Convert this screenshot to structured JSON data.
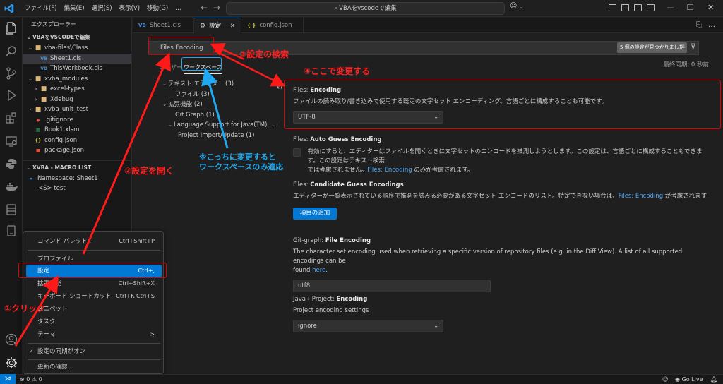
{
  "menubar": {
    "items": [
      "ファイル(F)",
      "編集(E)",
      "選択(S)",
      "表示(V)",
      "移動(G)",
      "…"
    ]
  },
  "command_center": {
    "text": "VBAをvscodeで編集"
  },
  "tabs": [
    {
      "icon": "VB",
      "label": "Sheet1.cls"
    },
    {
      "icon": "gear",
      "label": "設定"
    },
    {
      "icon": "{ }",
      "label": "config.json"
    }
  ],
  "sidebar": {
    "header": "エクスプローラー",
    "section_title": "VBAをVSCODEで編集",
    "tree": [
      {
        "label": "vba-files\\Class",
        "type": "folder",
        "open": true,
        "level": 1
      },
      {
        "label": "Sheet1.cls",
        "type": "vb",
        "level": 3,
        "selected": true
      },
      {
        "label": "ThisWorkbook.cls",
        "type": "vb",
        "level": 3
      },
      {
        "label": "xvba_modules",
        "type": "folder",
        "open": true,
        "level": 1
      },
      {
        "label": "excel-types",
        "type": "folder",
        "open": false,
        "level": 2
      },
      {
        "label": "Xdebug",
        "type": "folder",
        "open": false,
        "level": 2
      },
      {
        "label": "xvba_unit_test",
        "type": "folder",
        "open": false,
        "level": 1
      },
      {
        "label": ".gitignore",
        "type": "git",
        "level": 1
      },
      {
        "label": "Book1.xlsm",
        "type": "xls",
        "level": 1
      },
      {
        "label": "config.json",
        "type": "json",
        "level": 1
      },
      {
        "label": "package.json",
        "type": "pkg",
        "level": 1
      }
    ],
    "macro_section": "XVBA - MACRO LIST",
    "macro_items": [
      "Namespace: Sheet1",
      "<S> test"
    ]
  },
  "settings": {
    "search_value": "Files Encoding",
    "match_count": "5 個の設定が見つかりました",
    "scope_user": "ユーザー",
    "scope_workspace": "ワークスペース",
    "last_sync": "最終同期: 0 秒前",
    "toc": [
      {
        "label": "テキスト エディター (3)",
        "indent": 0,
        "chev": "v"
      },
      {
        "label": "ファイル (3)",
        "indent": 1,
        "chev": ""
      },
      {
        "label": "拡張機能 (2)",
        "indent": 0,
        "chev": "v"
      },
      {
        "label": "Git Graph (1)",
        "indent": 1,
        "chev": ""
      },
      {
        "label": "Language Support for Java(TM) ... (1)",
        "indent": 1,
        "chev": "v"
      },
      {
        "label": "Project Import/Update (1)",
        "indent": 2,
        "chev": ""
      }
    ],
    "files_encoding": {
      "prefix": "Files: ",
      "name": "Encoding",
      "desc": "ファイルの読み取り/書き込みで使用する既定の文字セット エンコーディング。言語ごとに構成することも可能です。",
      "value": "UTF-8"
    },
    "auto_guess": {
      "prefix": "Files: ",
      "name": "Auto Guess Encoding",
      "desc1": "有効にすると、エディターはファイルを開くときに文字セットのエンコードを推測しようとします。この設定は、言語ごとに構成することもできます。この設定はテキスト検索",
      "desc2a": "では考慮されません。",
      "desc2_link": "Files: Encoding",
      "desc2b": " のみが考慮されます。"
    },
    "candidate_guess": {
      "prefix": "Files: ",
      "name": "Candidate Guess Encodings",
      "desc_a": "エディターが一覧表示されている順序で推測を試みる必要がある文字セット エンコードのリスト。特定できない場合は、",
      "desc_link": "Files: Encoding",
      "desc_b": " が考慮されます",
      "button": "項目の追加"
    },
    "git_graph": {
      "prefix": "Git-graph: ",
      "name": "File Encoding",
      "desc1": "The character set encoding used when retrieving a specific version of repository files (e.g. in the Diff View). A list of all supported encodings can be",
      "desc2a": "found ",
      "desc2_link": "here",
      "desc2b": ".",
      "value": "utf8"
    },
    "java_project": {
      "prefix": "Java › Project: ",
      "name": "Encoding",
      "desc": "Project encoding settings",
      "value": "ignore"
    }
  },
  "context_menu": {
    "items": [
      {
        "label": "コマンド パレット...",
        "shortcut": "Ctrl+Shift+P"
      },
      {
        "label": "プロファイル",
        "shortcut": ""
      },
      {
        "label": "設定",
        "shortcut": "Ctrl+,",
        "highlight": true
      },
      {
        "label": "拡張機能",
        "shortcut": "Ctrl+Shift+X"
      },
      {
        "label": "キーボード ショートカット",
        "shortcut": "Ctrl+K Ctrl+S"
      },
      {
        "label": "スニペット",
        "shortcut": ""
      },
      {
        "label": "タスク",
        "shortcut": ""
      },
      {
        "label": "テーマ",
        "shortcut": ">"
      },
      {
        "label": "設定の同期がオン",
        "shortcut": "",
        "check": true
      },
      {
        "label": "更新の確認...",
        "shortcut": ""
      }
    ]
  },
  "statusbar": {
    "errors": "0",
    "warnings": "0",
    "go_live": "Go Live"
  },
  "annotations": {
    "step1": "①クリック",
    "step2": "②設定を開く",
    "step3": "③設定の検索",
    "step4": "④ここで変更する",
    "note_line1": "※こっちに変更すると",
    "note_line2": "ワークスペースのみ適応"
  },
  "colors": {
    "accent": "#0078d4",
    "annotation_red": "#ff2020",
    "annotation_blue": "#20a8f0",
    "link": "#4daafc"
  }
}
